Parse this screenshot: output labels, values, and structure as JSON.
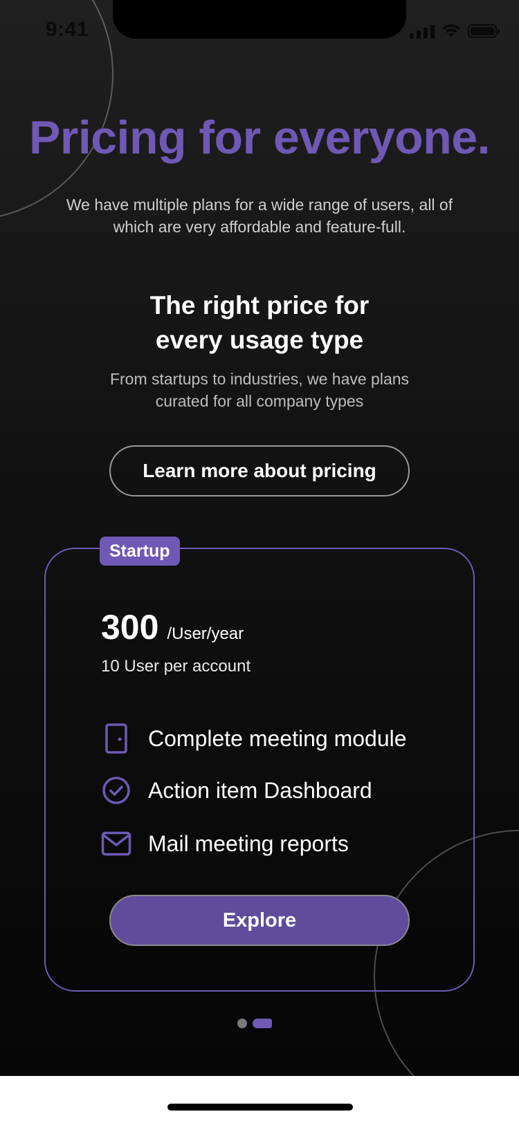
{
  "status_bar": {
    "time": "9:41"
  },
  "hero": {
    "title": "Pricing for everyone.",
    "subtitle": "We have multiple plans for a wide range of users, all of which are very affordable and feature-full."
  },
  "section": {
    "title_line1": "The right price for",
    "title_line2": "every usage type",
    "subtitle": "From startups to industries, we have plans curated for all company types",
    "learn_more_label": "Learn more about pricing"
  },
  "plan_card": {
    "badge": "Startup",
    "price": "300",
    "price_unit": "/User/year",
    "users_note": "10 User per account",
    "features": [
      {
        "icon": "door-icon",
        "label": "Complete meeting module"
      },
      {
        "icon": "check-circle-icon",
        "label": "Action item Dashboard"
      },
      {
        "icon": "mail-icon",
        "label": "Mail meeting reports"
      }
    ],
    "cta_label": "Explore"
  },
  "pagination": {
    "total": 2,
    "active_index": 1
  },
  "colors": {
    "accent": "#6E59B5",
    "background": "#111111",
    "text": "#FFFFFF"
  }
}
